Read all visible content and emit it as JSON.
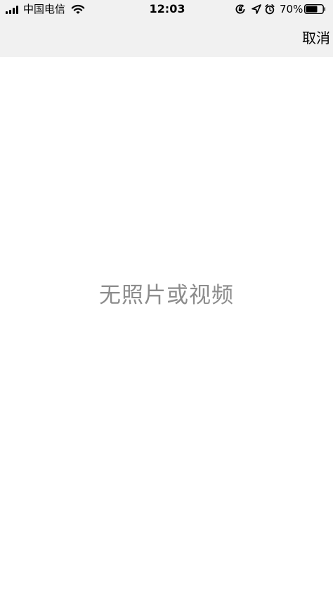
{
  "status_bar": {
    "carrier": "中国电信",
    "time": "12:03",
    "battery_percent": "70%",
    "battery_level": 0.7,
    "icons": [
      "signal-icon",
      "wifi-icon",
      "screen-rotation-lock-icon",
      "location-arrow-icon",
      "alarm-icon",
      "battery-icon"
    ]
  },
  "nav_bar": {
    "cancel_label": "取消"
  },
  "content": {
    "empty_message": "无照片或视频"
  },
  "colors": {
    "nav_background": "#f1f1f1",
    "empty_text": "#8c8c8c",
    "page_background": "#ffffff"
  }
}
